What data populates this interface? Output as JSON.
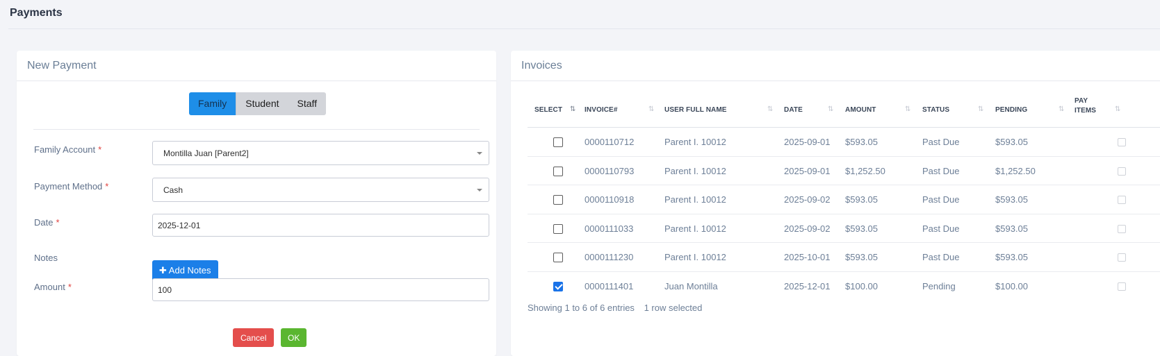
{
  "page": {
    "title": "Payments"
  },
  "new_payment": {
    "title": "New Payment",
    "segments": [
      "Family",
      "Student",
      "Staff"
    ],
    "active_segment": "Family",
    "fields": {
      "family_account": {
        "label": "Family Account",
        "value": "Montilla Juan [Parent2]"
      },
      "payment_method": {
        "label": "Payment Method",
        "value": "Cash"
      },
      "date": {
        "label": "Date",
        "value": "2025-12-01"
      },
      "notes": {
        "label": "Notes",
        "button": "✚ Add Notes"
      },
      "amount": {
        "label": "Amount",
        "value": "100"
      }
    },
    "required_mark": "*",
    "cancel_label": "Cancel",
    "ok_label": "OK"
  },
  "invoices": {
    "title": "Invoices",
    "columns": [
      "SELECT",
      "INVOICE#",
      "USER FULL NAME",
      "DATE",
      "AMOUNT",
      "STATUS",
      "PENDING",
      "PAY ITEMS"
    ],
    "rows": [
      {
        "selected": false,
        "invoice": "0000110712",
        "user": "Parent I. 10012",
        "date": "2025-09-01",
        "amount": "$593.05",
        "status": "Past Due",
        "pending": "$593.05"
      },
      {
        "selected": false,
        "invoice": "0000110793",
        "user": "Parent I. 10012",
        "date": "2025-09-01",
        "amount": "$1,252.50",
        "status": "Past Due",
        "pending": "$1,252.50"
      },
      {
        "selected": false,
        "invoice": "0000110918",
        "user": "Parent I. 10012",
        "date": "2025-09-02",
        "amount": "$593.05",
        "status": "Past Due",
        "pending": "$593.05"
      },
      {
        "selected": false,
        "invoice": "0000111033",
        "user": "Parent I. 10012",
        "date": "2025-09-02",
        "amount": "$593.05",
        "status": "Past Due",
        "pending": "$593.05"
      },
      {
        "selected": false,
        "invoice": "0000111230",
        "user": "Parent I. 10012",
        "date": "2025-10-01",
        "amount": "$593.05",
        "status": "Past Due",
        "pending": "$593.05"
      },
      {
        "selected": true,
        "invoice": "0000111401",
        "user": "Juan Montilla",
        "date": "2025-12-01",
        "amount": "$100.00",
        "status": "Pending",
        "pending": "$100.00"
      }
    ],
    "footer": {
      "showing": "Showing 1 to 6 of 6 entries",
      "selected": "1 row selected"
    }
  },
  "colors": {
    "primary": "#1b7fe8",
    "danger": "#e44e4c",
    "success": "#5ab630",
    "background": "#f3f4f8"
  },
  "icons": {
    "sort": "sort-arrows-icon",
    "dropdown": "caret-down-icon",
    "plus": "plus-icon"
  }
}
